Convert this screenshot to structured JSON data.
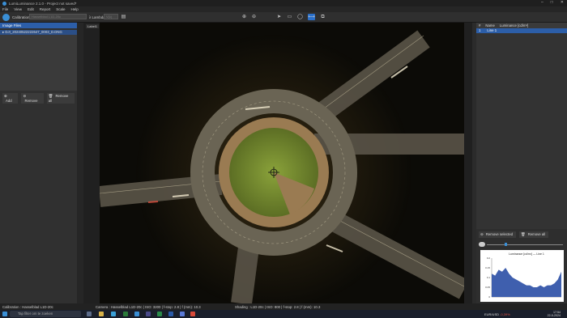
{
  "window": {
    "title": "LumiLuminance 2.1.0 - Project not saved*"
  },
  "menu": [
    "File",
    "View",
    "Edit",
    "Report",
    "Scale",
    "Help"
  ],
  "toolbar": {
    "calibration_label": "Calibration",
    "calibration_value": "Hasselblad L1D-20c",
    "lambda_label": "λ Lambda",
    "lambda_value": "V(λ)"
  },
  "left_panel": {
    "title": "Image Files",
    "files": [
      "DJI_20240522222647_0003_D.DNG"
    ],
    "add_label": "Add",
    "remove_label": "Remove",
    "remove_all_label": "Remove all"
  },
  "viewer": {
    "label": "Label1"
  },
  "right_panel": {
    "columns": [
      "#",
      "Name",
      "Luminance [cd/m²]"
    ],
    "rows": [
      {
        "index": "1",
        "name": "Line 1",
        "value": ""
      }
    ],
    "remove_selected_label": "Remove selected",
    "remove_all_label": "Remove all",
    "chart_title": "Luminance [cd/m²] — Line 1"
  },
  "chart_data": {
    "type": "area",
    "title": "Luminance [cd/m²] — Line 1",
    "y_ticks": [
      "0.2",
      "0.15",
      "0.1",
      "0.05",
      "0"
    ],
    "x": [
      0,
      5,
      10,
      15,
      20,
      25,
      30,
      35,
      40,
      45,
      50,
      55,
      60,
      65,
      70,
      75,
      80,
      85,
      90,
      95,
      100
    ],
    "values": [
      0.12,
      0.11,
      0.14,
      0.13,
      0.15,
      0.12,
      0.1,
      0.09,
      0.08,
      0.07,
      0.06,
      0.06,
      0.05,
      0.05,
      0.06,
      0.05,
      0.06,
      0.06,
      0.07,
      0.09,
      0.13
    ],
    "ylim": [
      0,
      0.2
    ]
  },
  "status": {
    "calibration": "Calibration : Hasselblad L1D-20c",
    "camera": "Camera : Hasselblad L1D-20c | ISO: 3200 | f-stop: 2.8 | f (mm): 10.3",
    "shading": "Shading : L1D-20c | ISO: 800 | f-stop: 2.8 | f (mm): 10.3"
  },
  "taskbar": {
    "search_placeholder": "Tap filter om te zoeken",
    "currency": "EUR/USD",
    "currency_change": "-0,39%",
    "time": "17:54",
    "date": "22-5-2024"
  },
  "colors": {
    "accent": "#2c5ea8",
    "histogram": "#3f5fae"
  }
}
